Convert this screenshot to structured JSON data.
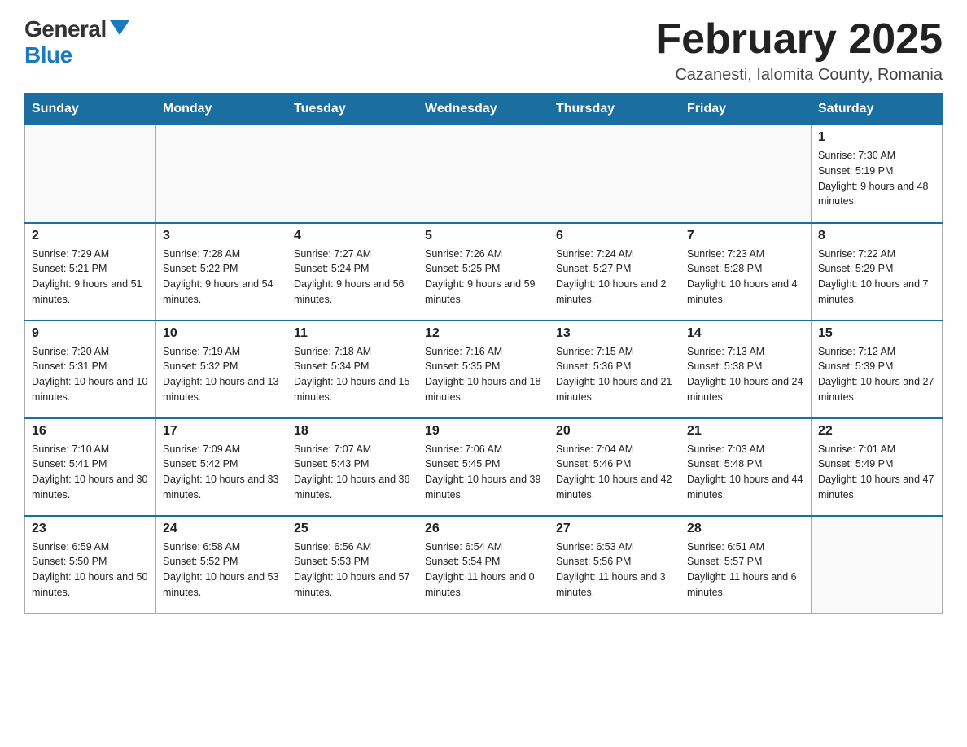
{
  "header": {
    "logo_general": "General",
    "logo_blue": "Blue",
    "month_title": "February 2025",
    "location": "Cazanesti, Ialomita County, Romania"
  },
  "weekdays": [
    "Sunday",
    "Monday",
    "Tuesday",
    "Wednesday",
    "Thursday",
    "Friday",
    "Saturday"
  ],
  "weeks": [
    [
      {
        "day": "",
        "info": ""
      },
      {
        "day": "",
        "info": ""
      },
      {
        "day": "",
        "info": ""
      },
      {
        "day": "",
        "info": ""
      },
      {
        "day": "",
        "info": ""
      },
      {
        "day": "",
        "info": ""
      },
      {
        "day": "1",
        "info": "Sunrise: 7:30 AM\nSunset: 5:19 PM\nDaylight: 9 hours and 48 minutes."
      }
    ],
    [
      {
        "day": "2",
        "info": "Sunrise: 7:29 AM\nSunset: 5:21 PM\nDaylight: 9 hours and 51 minutes."
      },
      {
        "day": "3",
        "info": "Sunrise: 7:28 AM\nSunset: 5:22 PM\nDaylight: 9 hours and 54 minutes."
      },
      {
        "day": "4",
        "info": "Sunrise: 7:27 AM\nSunset: 5:24 PM\nDaylight: 9 hours and 56 minutes."
      },
      {
        "day": "5",
        "info": "Sunrise: 7:26 AM\nSunset: 5:25 PM\nDaylight: 9 hours and 59 minutes."
      },
      {
        "day": "6",
        "info": "Sunrise: 7:24 AM\nSunset: 5:27 PM\nDaylight: 10 hours and 2 minutes."
      },
      {
        "day": "7",
        "info": "Sunrise: 7:23 AM\nSunset: 5:28 PM\nDaylight: 10 hours and 4 minutes."
      },
      {
        "day": "8",
        "info": "Sunrise: 7:22 AM\nSunset: 5:29 PM\nDaylight: 10 hours and 7 minutes."
      }
    ],
    [
      {
        "day": "9",
        "info": "Sunrise: 7:20 AM\nSunset: 5:31 PM\nDaylight: 10 hours and 10 minutes."
      },
      {
        "day": "10",
        "info": "Sunrise: 7:19 AM\nSunset: 5:32 PM\nDaylight: 10 hours and 13 minutes."
      },
      {
        "day": "11",
        "info": "Sunrise: 7:18 AM\nSunset: 5:34 PM\nDaylight: 10 hours and 15 minutes."
      },
      {
        "day": "12",
        "info": "Sunrise: 7:16 AM\nSunset: 5:35 PM\nDaylight: 10 hours and 18 minutes."
      },
      {
        "day": "13",
        "info": "Sunrise: 7:15 AM\nSunset: 5:36 PM\nDaylight: 10 hours and 21 minutes."
      },
      {
        "day": "14",
        "info": "Sunrise: 7:13 AM\nSunset: 5:38 PM\nDaylight: 10 hours and 24 minutes."
      },
      {
        "day": "15",
        "info": "Sunrise: 7:12 AM\nSunset: 5:39 PM\nDaylight: 10 hours and 27 minutes."
      }
    ],
    [
      {
        "day": "16",
        "info": "Sunrise: 7:10 AM\nSunset: 5:41 PM\nDaylight: 10 hours and 30 minutes."
      },
      {
        "day": "17",
        "info": "Sunrise: 7:09 AM\nSunset: 5:42 PM\nDaylight: 10 hours and 33 minutes."
      },
      {
        "day": "18",
        "info": "Sunrise: 7:07 AM\nSunset: 5:43 PM\nDaylight: 10 hours and 36 minutes."
      },
      {
        "day": "19",
        "info": "Sunrise: 7:06 AM\nSunset: 5:45 PM\nDaylight: 10 hours and 39 minutes."
      },
      {
        "day": "20",
        "info": "Sunrise: 7:04 AM\nSunset: 5:46 PM\nDaylight: 10 hours and 42 minutes."
      },
      {
        "day": "21",
        "info": "Sunrise: 7:03 AM\nSunset: 5:48 PM\nDaylight: 10 hours and 44 minutes."
      },
      {
        "day": "22",
        "info": "Sunrise: 7:01 AM\nSunset: 5:49 PM\nDaylight: 10 hours and 47 minutes."
      }
    ],
    [
      {
        "day": "23",
        "info": "Sunrise: 6:59 AM\nSunset: 5:50 PM\nDaylight: 10 hours and 50 minutes."
      },
      {
        "day": "24",
        "info": "Sunrise: 6:58 AM\nSunset: 5:52 PM\nDaylight: 10 hours and 53 minutes."
      },
      {
        "day": "25",
        "info": "Sunrise: 6:56 AM\nSunset: 5:53 PM\nDaylight: 10 hours and 57 minutes."
      },
      {
        "day": "26",
        "info": "Sunrise: 6:54 AM\nSunset: 5:54 PM\nDaylight: 11 hours and 0 minutes."
      },
      {
        "day": "27",
        "info": "Sunrise: 6:53 AM\nSunset: 5:56 PM\nDaylight: 11 hours and 3 minutes."
      },
      {
        "day": "28",
        "info": "Sunrise: 6:51 AM\nSunset: 5:57 PM\nDaylight: 11 hours and 6 minutes."
      },
      {
        "day": "",
        "info": ""
      }
    ]
  ]
}
